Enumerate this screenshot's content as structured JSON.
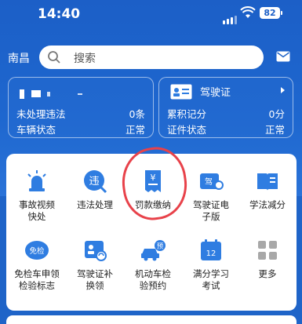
{
  "status_bar": {
    "time": "14:40",
    "battery": "82"
  },
  "topbar": {
    "city": "南昌",
    "search_placeholder": "搜索"
  },
  "vehicle_card": {
    "rows": [
      {
        "label": "未处理违法",
        "value": "0条"
      },
      {
        "label": "车辆状态",
        "value": "正常"
      }
    ]
  },
  "license_card": {
    "title": "驾驶证",
    "rows": [
      {
        "label": "累积记分",
        "value": "0分"
      },
      {
        "label": "证件状态",
        "value": "正常"
      }
    ]
  },
  "services": [
    {
      "label": "事故视频\n快处",
      "icon": "siren-icon"
    },
    {
      "label": "违法处理",
      "icon": "violation-icon"
    },
    {
      "label": "罚款缴纳",
      "icon": "fine-payment-icon"
    },
    {
      "label": "驾驶证电\n子版",
      "icon": "license-wallet-icon"
    },
    {
      "label": "学法减分",
      "icon": "book-icon"
    },
    {
      "label": "免检车申领\n检验标志",
      "icon": "exempt-inspection-icon"
    },
    {
      "label": "驾驶证补\n换领",
      "icon": "license-replace-icon"
    },
    {
      "label": "机动车检\n验预约",
      "icon": "car-inspection-icon"
    },
    {
      "label": "满分学习\n考试",
      "icon": "calendar-exam-icon"
    },
    {
      "label": "更多",
      "icon": "more-grid-icon"
    }
  ],
  "colors": {
    "brand_blue": "#1f64c8",
    "icon_blue": "#2f7de1",
    "annotation_red": "#e8424a"
  },
  "service_icon_texts": {
    "violation": "违",
    "exempt": "免检",
    "inspection": "预",
    "exam": "12",
    "fine": "¥",
    "license": "驾"
  }
}
